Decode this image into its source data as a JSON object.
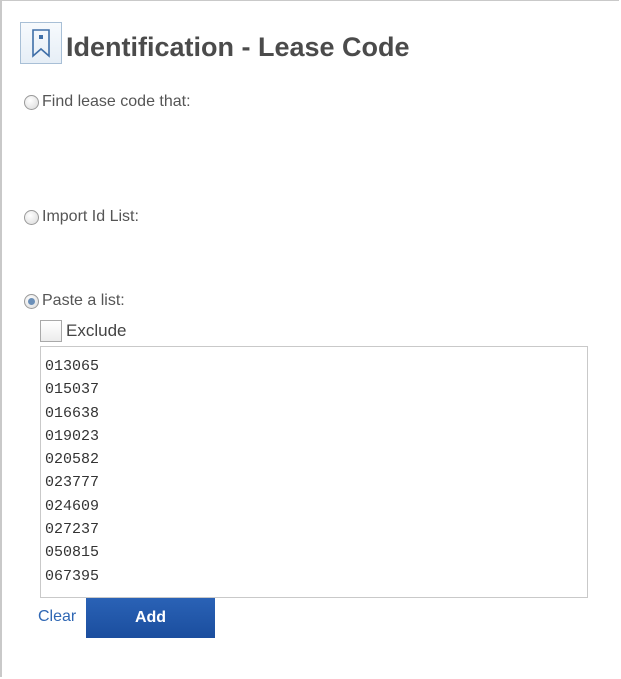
{
  "header": {
    "title": "Identification - Lease Code",
    "icon": "bookmark-icon"
  },
  "options": {
    "find": {
      "label": "Find lease code that:",
      "selected": false
    },
    "import": {
      "label": "Import Id List:",
      "selected": false
    },
    "paste": {
      "label": "Paste a list:",
      "selected": true
    }
  },
  "exclude": {
    "label": "Exclude",
    "checked": false
  },
  "list_items": [
    "013065",
    "015037",
    "016638",
    "019023",
    "020582",
    "023777",
    "024609",
    "027237",
    "050815",
    "067395"
  ],
  "actions": {
    "clear_label": "Clear",
    "add_label": "Add"
  },
  "colors": {
    "accent": "#1f56a8",
    "link": "#2f67b4",
    "title": "#4b4b4b"
  }
}
